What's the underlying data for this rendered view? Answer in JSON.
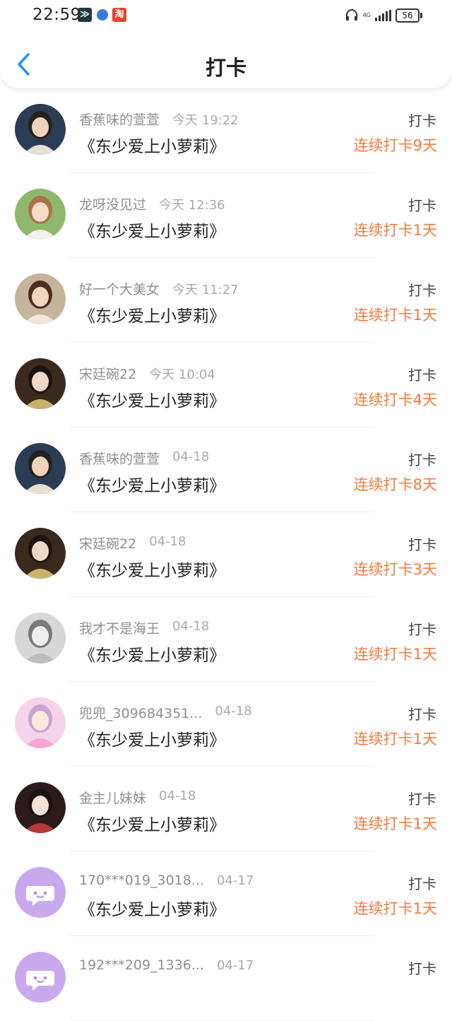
{
  "status_bar": {
    "time": "22:59",
    "network": "4G",
    "battery": "56"
  },
  "header": {
    "title": "打卡"
  },
  "colors": {
    "streak": "#f27a3c",
    "back_arrow": "#2196f3",
    "purple_avatar": "#c9a9ee"
  },
  "checkins": [
    {
      "user": "香蕉味的萱萱",
      "time": "今天 19:22",
      "book": "《东少爱上小萝莉》",
      "action": "打卡",
      "streak": "连续打卡9天",
      "avatar": "boy-photo"
    },
    {
      "user": "龙呀没见过",
      "time": "今天 12:36",
      "book": "《东少爱上小萝莉》",
      "action": "打卡",
      "streak": "连续打卡1天",
      "avatar": "girl-photo-light"
    },
    {
      "user": "好一个大美女",
      "time": "今天 11:27",
      "book": "《东少爱上小萝莉》",
      "action": "打卡",
      "streak": "连续打卡1天",
      "avatar": "girl-photo-brown"
    },
    {
      "user": "宋廷碗22",
      "time": "今天 10:04",
      "book": "《东少爱上小萝莉》",
      "action": "打卡",
      "streak": "连续打卡4天",
      "avatar": "costume-photo"
    },
    {
      "user": "香蕉味的萱萱",
      "time": "04-18",
      "book": "《东少爱上小萝莉》",
      "action": "打卡",
      "streak": "连续打卡8天",
      "avatar": "boy-photo"
    },
    {
      "user": "宋廷碗22",
      "time": "04-18",
      "book": "《东少爱上小萝莉》",
      "action": "打卡",
      "streak": "连续打卡3天",
      "avatar": "costume-photo"
    },
    {
      "user": "我才不是海王",
      "time": "04-18",
      "book": "《东少爱上小萝莉》",
      "action": "打卡",
      "streak": "连续打卡1天",
      "avatar": "sketch-photo"
    },
    {
      "user": "兜兜_309684351...",
      "time": "04-18",
      "book": "《东少爱上小萝莉》",
      "action": "打卡",
      "streak": "连续打卡1天",
      "avatar": "anime-pink"
    },
    {
      "user": "金主儿妹妹",
      "time": "04-18",
      "book": "《东少爱上小萝莉》",
      "action": "打卡",
      "streak": "连续打卡1天",
      "avatar": "anime-dark"
    },
    {
      "user": "170***019_3018...",
      "time": "04-17",
      "book": "《东少爱上小萝莉》",
      "action": "打卡",
      "streak": "连续打卡1天",
      "avatar": "default-chat"
    },
    {
      "user": "192***209_1336...",
      "time": "04-17",
      "book": "",
      "action": "打卡",
      "streak": "",
      "avatar": "default-chat"
    }
  ]
}
